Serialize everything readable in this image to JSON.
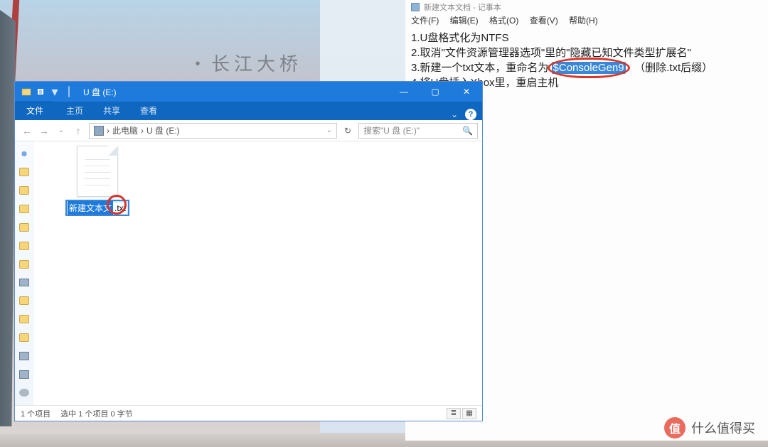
{
  "desktop": {
    "banner_text": "・长江大桥"
  },
  "notepad": {
    "title_prefix": "新建文本文档 - 记事本",
    "menu": {
      "file": "文件(F)",
      "edit": "编辑(E)",
      "format": "格式(O)",
      "view": "查看(V)",
      "help": "帮助(H)"
    },
    "lines": {
      "l1": "1.U盘格式化为NTFS",
      "l2_a": "2.取消\"文件资源管理器选项\"里的\"隐藏已知文件类型扩展名\"",
      "l3_a": "3.新建一个txt文本，重命名为",
      "l3_hl": "$ConsoleGen9",
      "l3_b": "（删除.txt后缀）",
      "l4": "4.将U盘插入Xbox里，重启主机"
    }
  },
  "explorer": {
    "titlebar": {
      "title": "U 盘 (E:)"
    },
    "ribbon": {
      "file": "文件",
      "tabs": {
        "home": "主页",
        "share": "共享",
        "view": "查看"
      },
      "help_glyph": "?"
    },
    "address": {
      "back": "←",
      "fwd": "→",
      "up": "↑",
      "chevron": "›",
      "crumb_root": "此电脑",
      "crumb_drive": "U 盘 (E:)",
      "dropdown": "⌄",
      "reload": "↻",
      "search_placeholder": "搜索\"U 盘 (E:)\"",
      "search_icon": "🔍"
    },
    "file": {
      "name_selected": "新建文本文",
      "name_ext": ".txt"
    },
    "status": {
      "count": "1 个项目",
      "selection": "选中 1 个项目  0 字节"
    },
    "wincontrols": {
      "min": "—",
      "max": "▢",
      "close": "✕"
    }
  },
  "watermark": {
    "logo_char": "值",
    "text": "什么值得买"
  }
}
